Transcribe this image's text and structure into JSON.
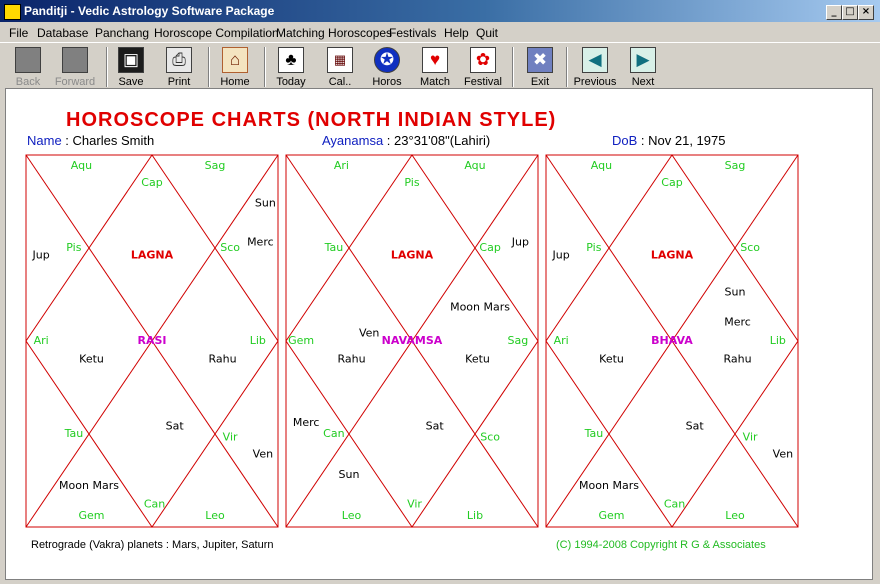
{
  "window": {
    "title": "Panditji - Vedic Astrology Software Package"
  },
  "menu": [
    "File",
    "Database",
    "Panchang",
    "Horoscope Compilation",
    "Matching Horoscopes",
    "Festivals",
    "Help",
    "Quit"
  ],
  "toolbar": [
    {
      "label": "Back",
      "icon": "back-icon",
      "enabled": false
    },
    {
      "label": "Forward",
      "icon": "forward-icon",
      "enabled": false
    },
    {
      "label": "Save",
      "icon": "floppy-icon",
      "enabled": true
    },
    {
      "label": "Print",
      "icon": "printer-icon",
      "enabled": true
    },
    {
      "label": "Home",
      "icon": "home-icon",
      "enabled": true
    },
    {
      "label": "Today",
      "icon": "club-card-icon",
      "enabled": true
    },
    {
      "label": "Cal..",
      "icon": "calculator-icon",
      "enabled": true
    },
    {
      "label": "Horos",
      "icon": "horoscope-icon",
      "enabled": true
    },
    {
      "label": "Match",
      "icon": "heart-card-icon",
      "enabled": true
    },
    {
      "label": "Festival",
      "icon": "festival-icon",
      "enabled": true
    },
    {
      "label": "Exit",
      "icon": "exit-icon",
      "enabled": true
    },
    {
      "label": "Previous",
      "icon": "previous-arrow-icon",
      "enabled": true
    },
    {
      "label": "Next",
      "icon": "next-arrow-icon",
      "enabled": true
    }
  ],
  "page": {
    "heading": "HOROSCOPE CHARTS (NORTH INDIAN STYLE)",
    "name_label": "Name",
    "name_value": "Charles Smith",
    "ayanamsa_label": "Ayanamsa",
    "ayanamsa_value": "23°31'08\"(Lahiri)",
    "dob_label": "DoB",
    "dob_value": "Nov 21, 1975"
  },
  "charts": [
    {
      "center": "RASI",
      "top": "LAGNA",
      "signs": [
        "Aqu",
        "Cap",
        "Sag",
        "Sco",
        "Lib",
        "Vir",
        "Leo",
        "Can",
        "Gem",
        "Tau",
        "Ari",
        "Pis"
      ],
      "planets": {
        "1": "",
        "2": "",
        "3": "Sun",
        "4": "Merc",
        "5": "Rahu",
        "6": "",
        "7": "Sat",
        "8": "Ven",
        "9": "",
        "10": "Moon Mars",
        "11": "",
        "12": "Ketu",
        "13": "Jup"
      }
    },
    {
      "center": "NAVAMSA",
      "top": "LAGNA",
      "signs": [
        "Ari",
        "Pis",
        "Aqu",
        "Cap",
        "Sag",
        "Sco",
        "Lib",
        "Vir",
        "Leo",
        "Can",
        "Gem",
        "Tau"
      ],
      "planets": {
        "1": "Ven",
        "2": "",
        "3": "",
        "4": "Jup",
        "5": "Moon Mars",
        "6": "Ketu",
        "7": "Sat",
        "8": "",
        "9": "",
        "10": "Sun",
        "11": "Merc",
        "12": "Rahu",
        "13": ""
      }
    },
    {
      "center": "BHAVA",
      "top": "LAGNA",
      "signs": [
        "Aqu",
        "Cap",
        "Sag",
        "Sco",
        "Lib",
        "Vir",
        "Leo",
        "Can",
        "Gem",
        "Tau",
        "Ari",
        "Pis"
      ],
      "planets": {
        "1": "Sun",
        "2": "",
        "3": "",
        "4": "Merc",
        "5": "Rahu",
        "6": "",
        "7": "Sat",
        "8": "Ven",
        "9": "",
        "10": "Moon Mars",
        "11": "",
        "12": "Ketu",
        "13": "Jup"
      }
    }
  ],
  "footer": {
    "retro": "Retrograde (Vakra) planets : Mars,  Jupiter,  Saturn",
    "copyright": "(C) 1994-2008 Copyright R G & Associates"
  },
  "colors": {
    "grid": "#d00000",
    "sign": "#22cc22",
    "lagna": "#e00000",
    "center": "#cc00cc",
    "planet": "#000000",
    "label": "#1020c0"
  }
}
